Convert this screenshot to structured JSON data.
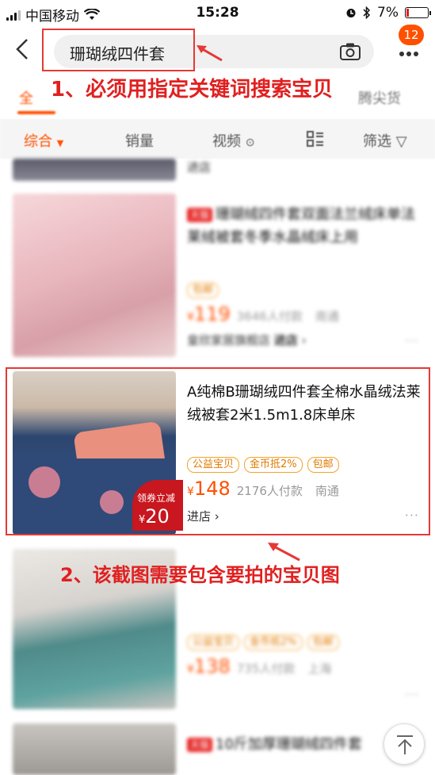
{
  "status": {
    "carrier": "中国移动",
    "time": "15:28",
    "battery": "7%"
  },
  "search": {
    "query": "珊瑚绒四件套",
    "badge": "12"
  },
  "annotation1": "1、必须用指定关键词搜索宝贝",
  "tabs": [
    {
      "label": "全"
    },
    {
      "label": "尖货"
    }
  ],
  "tab_suffix": "腾",
  "filters": [
    {
      "label": "综合"
    },
    {
      "label": "销量"
    },
    {
      "label": "视频"
    },
    {
      "label": "筛选"
    }
  ],
  "items": [
    {
      "title": "",
      "shop": "进店"
    },
    {
      "tmall": "天猫",
      "title": "珊瑚绒四件套双面法兰绒床单法莱绒被套冬季水晶绒床上用",
      "tags": [
        "包邮"
      ],
      "price": "119",
      "sales": "3646人付款",
      "loc": "南通",
      "shop": "皇欣家居旗舰店",
      "shop_link": "进店"
    },
    {
      "title": "A纯棉B珊瑚绒四件套全棉水晶绒法莱绒被套2米1.5m1.8床单床",
      "tags": [
        "公益宝贝",
        "金币抵2%",
        "包邮"
      ],
      "price": "148",
      "sales": "2176人付款",
      "loc": "南通",
      "shop": "进店",
      "coupon": {
        "line1": "领券立减",
        "currency": "¥",
        "amount": "20"
      }
    },
    {
      "title": "",
      "tags": [
        "公益宝贝",
        "金币抵2%",
        "包邮"
      ],
      "price": "138",
      "sales": "735人付款",
      "loc": "上海"
    },
    {
      "tmall": "天猫",
      "title": "10斤加厚珊瑚绒四件套"
    }
  ],
  "annotation2": "2、该截图需要包含要拍的宝贝图",
  "currency": "¥",
  "colors": {
    "accent": "#ff5000",
    "highlight": "#e53935"
  }
}
